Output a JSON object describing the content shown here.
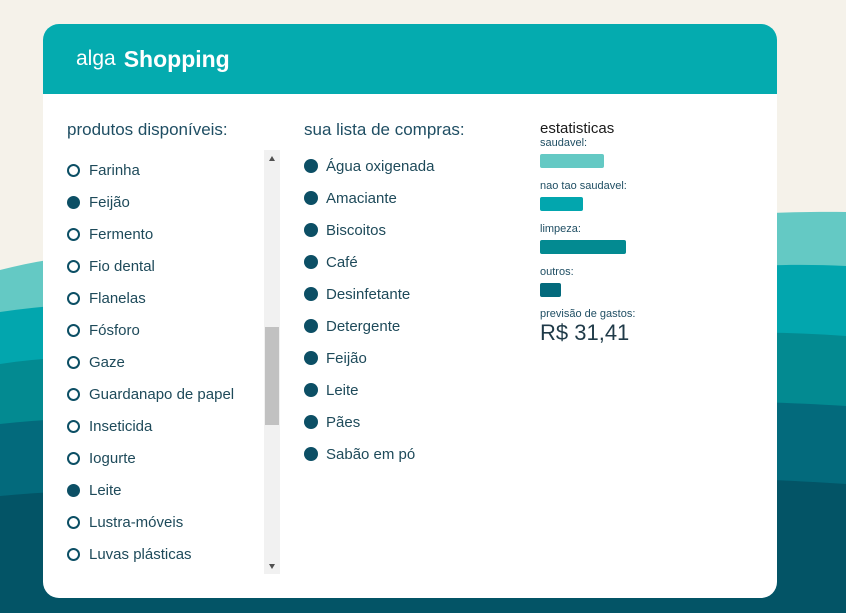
{
  "brand": {
    "light": "alga",
    "bold": "Shopping"
  },
  "colors": {
    "header": "#04abaf",
    "radio": "#0c4f65",
    "waves": [
      "#64c9c4",
      "#02a6ae",
      "#038a91",
      "#036a7c",
      "#035466"
    ]
  },
  "products": {
    "title": "produtos disponíveis:",
    "items": [
      {
        "label": "Farinha",
        "selected": false
      },
      {
        "label": "Feijão",
        "selected": true
      },
      {
        "label": "Fermento",
        "selected": false
      },
      {
        "label": "Fio dental",
        "selected": false
      },
      {
        "label": "Flanelas",
        "selected": false
      },
      {
        "label": "Fósforo",
        "selected": false
      },
      {
        "label": "Gaze",
        "selected": false
      },
      {
        "label": "Guardanapo de papel",
        "selected": false
      },
      {
        "label": "Inseticida",
        "selected": false
      },
      {
        "label": "Iogurte",
        "selected": false
      },
      {
        "label": "Leite",
        "selected": true
      },
      {
        "label": "Lustra-móveis",
        "selected": false
      },
      {
        "label": "Luvas plásticas",
        "selected": false
      }
    ]
  },
  "shopping_list": {
    "title": "sua lista de compras:",
    "items": [
      "Água oxigenada",
      "Amaciante",
      "Biscoitos",
      "Café",
      "Desinfetante",
      "Detergente",
      "Feijão",
      "Leite",
      "Pães",
      "Sabão em pó"
    ]
  },
  "stats": {
    "title": "estatisticas",
    "bars": [
      {
        "label": "saudavel:",
        "value": 0.48,
        "color": "#64c9c4"
      },
      {
        "label": "nao tao saudavel:",
        "value": 0.32,
        "color": "#02a6ae"
      },
      {
        "label": "limpeza:",
        "value": 0.64,
        "color": "#038a91"
      },
      {
        "label": "outros:",
        "value": 0.16,
        "color": "#036a7c"
      }
    ],
    "forecast_label": "previsão de gastos:",
    "forecast_value": "R$ 31,41"
  }
}
